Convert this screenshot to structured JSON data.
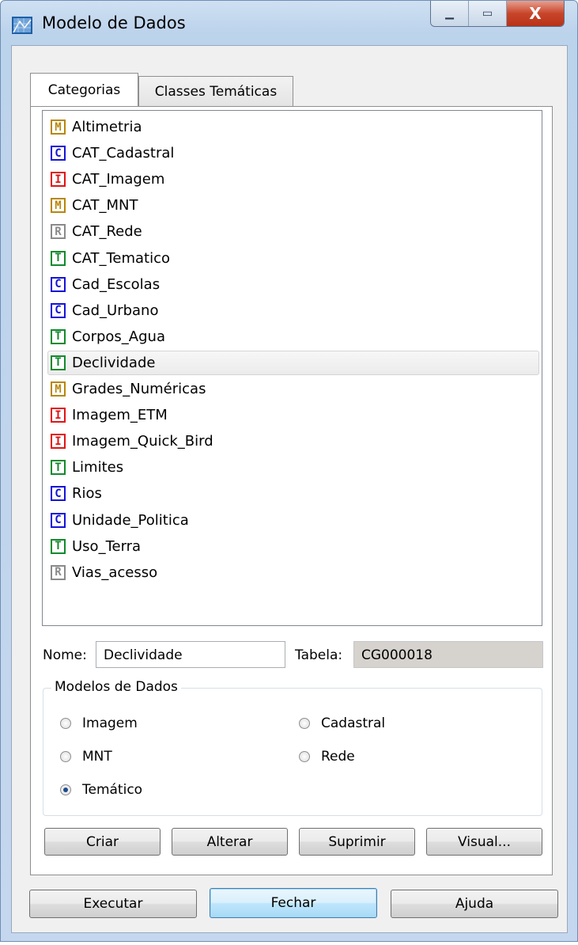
{
  "window": {
    "title": "Modelo de Dados",
    "controls": {
      "minimize": "▁",
      "maximize": "▭",
      "close": "X"
    }
  },
  "tabs": [
    {
      "label": "Categorias",
      "active": true
    },
    {
      "label": "Classes Temáticas",
      "active": false
    }
  ],
  "categories": [
    {
      "type": "M",
      "name": "Altimetria"
    },
    {
      "type": "C",
      "name": "CAT_Cadastral"
    },
    {
      "type": "I",
      "name": "CAT_Imagem"
    },
    {
      "type": "M",
      "name": "CAT_MNT"
    },
    {
      "type": "R",
      "name": "CAT_Rede"
    },
    {
      "type": "T",
      "name": "CAT_Tematico"
    },
    {
      "type": "C",
      "name": "Cad_Escolas"
    },
    {
      "type": "C",
      "name": "Cad_Urbano"
    },
    {
      "type": "T",
      "name": "Corpos_Agua"
    },
    {
      "type": "T",
      "name": "Declividade",
      "selected": true
    },
    {
      "type": "M",
      "name": "Grades_Numéricas"
    },
    {
      "type": "I",
      "name": "Imagem_ETM"
    },
    {
      "type": "I",
      "name": "Imagem_Quick_Bird"
    },
    {
      "type": "T",
      "name": "Limites"
    },
    {
      "type": "C",
      "name": "Rios"
    },
    {
      "type": "C",
      "name": "Unidade_Politica"
    },
    {
      "type": "T",
      "name": "Uso_Terra"
    },
    {
      "type": "R",
      "name": "Vias_acesso"
    }
  ],
  "type_colors": {
    "M": "#b8860b",
    "C": "#1414d8",
    "I": "#e01414",
    "R": "#8a8a8a",
    "T": "#138a2e"
  },
  "form": {
    "nome_label": "Nome:",
    "nome_value": "Declividade",
    "tabela_label": "Tabela:",
    "tabela_value": "CG000018"
  },
  "models_group": {
    "title": "Modelos de Dados",
    "options": [
      {
        "label": "Imagem",
        "checked": false
      },
      {
        "label": "Cadastral",
        "checked": false
      },
      {
        "label": "MNT",
        "checked": false
      },
      {
        "label": "Rede",
        "checked": false
      },
      {
        "label": "Temático",
        "checked": true
      }
    ]
  },
  "panel_buttons": [
    "Criar",
    "Alterar",
    "Suprimir",
    "Visual..."
  ],
  "dialog_buttons": [
    "Executar",
    "Fechar",
    "Ajuda"
  ]
}
